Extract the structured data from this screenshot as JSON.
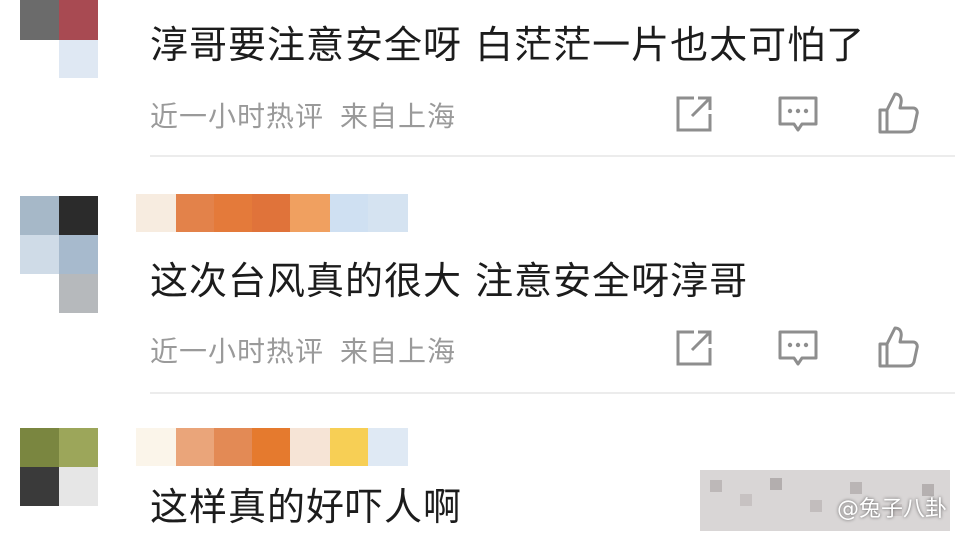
{
  "comments": [
    {
      "text": "淳哥要注意安全呀 白茫茫一片也太可怕了",
      "time": "近一小时热评",
      "location": "来自上海",
      "avatar_colors": [
        "#6b6b6b",
        "#a84a52",
        "#ffffff",
        "#dfe8f3"
      ],
      "name_colors": []
    },
    {
      "text": "这次台风真的很大 注意安全呀淳哥",
      "time": "近一小时热评",
      "location": "来自上海",
      "avatar_colors": [
        "#a6b8c8",
        "#2b2b2b",
        "#ffffff",
        "#cfdbe7",
        "#a7bacd",
        "#ffffff",
        "#ffffff",
        "#b6b9bc",
        "#ffffff"
      ],
      "name_colors": [
        "#f7ece0",
        "#e3824a",
        "#e47a3a",
        "#e0733a",
        "#f0a060",
        "#cfe0f2",
        "#d5e3f1"
      ]
    },
    {
      "text": "这样真的好吓人啊",
      "time": "",
      "location": "",
      "avatar_colors": [
        "#7a8640",
        "#9ca65a",
        "#ffffff",
        "#3a3a3a",
        "#e6e6e6",
        "#ffffff"
      ],
      "name_colors": [
        "#fbf5ea",
        "#eaa57a",
        "#e38a55",
        "#e57a2e",
        "#f6e4d6",
        "#f7cf55",
        "#dfe9f4"
      ]
    }
  ],
  "actions": {
    "share_icon": "share-icon",
    "reply_icon": "comment-icon",
    "like_icon": "thumbs-up-icon"
  },
  "watermark": "@兔子八卦",
  "colors": {
    "text": "#1c1c1c",
    "meta": "#9a9a9a",
    "icon": "#8e8e8e",
    "divider": "#ececec"
  }
}
